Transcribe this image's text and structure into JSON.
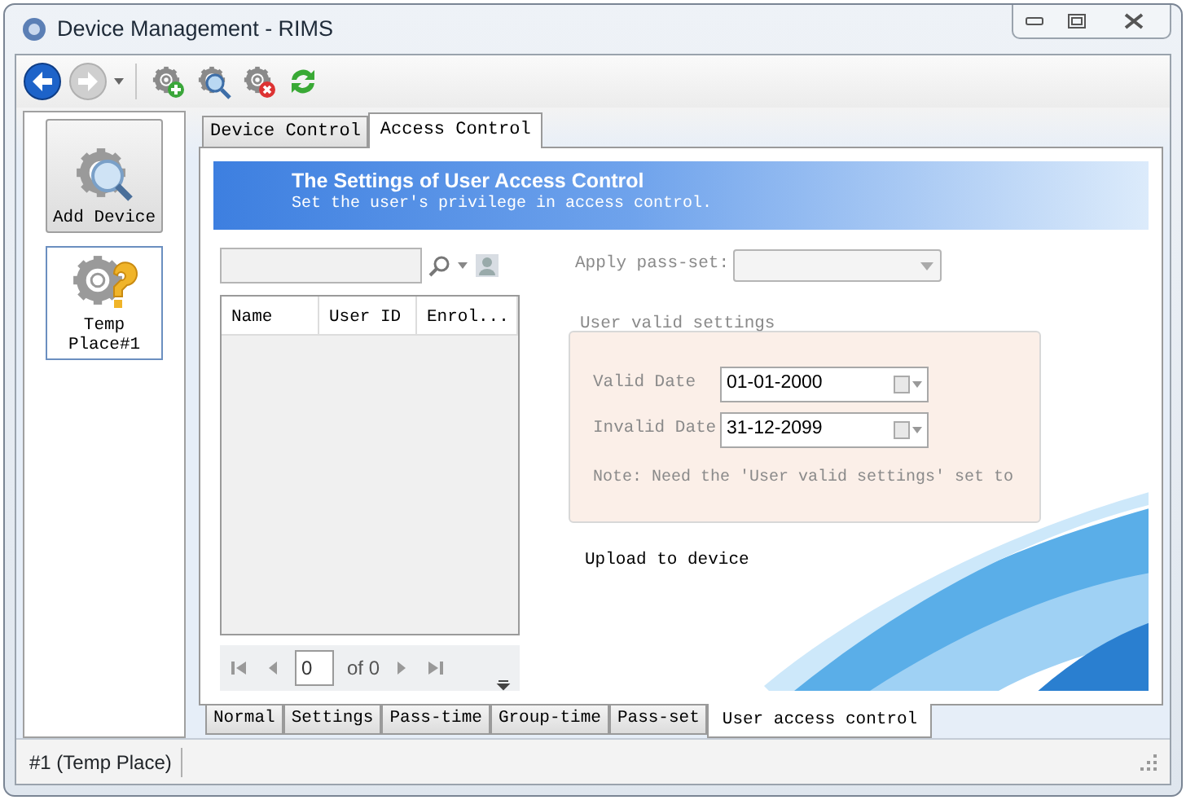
{
  "window": {
    "title": "Device Management - RIMS"
  },
  "toolbar": {
    "buttons": [
      {
        "kind": "back",
        "disabled": false
      },
      {
        "kind": "forward",
        "disabled": true
      },
      {
        "kind": "add",
        "disabled": false
      },
      {
        "kind": "search",
        "disabled": false
      },
      {
        "kind": "remove",
        "disabled": false
      },
      {
        "kind": "refresh",
        "disabled": false
      }
    ]
  },
  "sidebar": {
    "items": [
      {
        "kind": "add",
        "label": "Add Device",
        "selected": false
      },
      {
        "kind": "place",
        "label": "Temp Place#1",
        "selected": true
      }
    ]
  },
  "tabs": [
    {
      "label": "Device Control",
      "selected": false
    },
    {
      "label": "Access Control",
      "selected": true
    }
  ],
  "banner": {
    "title": "The Settings of User Access Control",
    "subtitle": "Set the user's privilege in access control."
  },
  "table": {
    "columns": [
      "Name",
      "User ID",
      "Enrol..."
    ]
  },
  "pager": {
    "page": "0",
    "total": "of 0"
  },
  "apply_pass_set": {
    "label": "Apply pass-set:",
    "disabled": true
  },
  "valid_settings": {
    "legend": "User valid settings",
    "fields": [
      {
        "label": "Valid Date",
        "value": "01-01-2000"
      },
      {
        "label": "Invalid Date",
        "value": "31-12-2099"
      }
    ],
    "note": "Note: Need the 'User valid settings' set to"
  },
  "upload": {
    "label": "Upload to device"
  },
  "bottom_tabs": [
    {
      "label": "Normal",
      "selected": false
    },
    {
      "label": "Settings",
      "selected": false
    },
    {
      "label": "Pass-time",
      "selected": false
    },
    {
      "label": "Group-time",
      "selected": false
    },
    {
      "label": "Pass-set",
      "selected": false
    },
    {
      "label": "User access control",
      "selected": true
    }
  ],
  "status_bar": {
    "text": "#1 (Temp Place)"
  }
}
